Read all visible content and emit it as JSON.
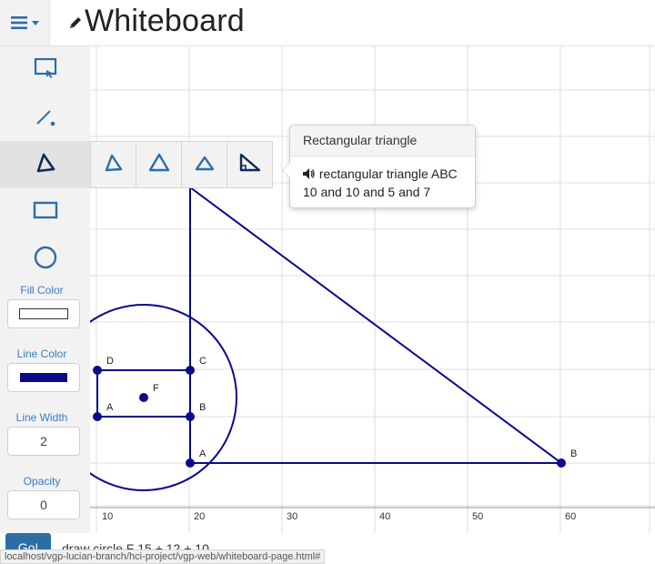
{
  "header": {
    "title": "Whiteboard",
    "menu_icon": "hamburger-icon",
    "title_icon": "pencil-icon"
  },
  "sidebar": {
    "tools": [
      {
        "name": "select",
        "icon": "select-icon"
      },
      {
        "name": "line",
        "icon": "line-icon"
      },
      {
        "name": "triangle",
        "icon": "triangle-icon",
        "active": true
      },
      {
        "name": "rectangle",
        "icon": "rectangle-icon"
      },
      {
        "name": "circle",
        "icon": "circle-icon"
      }
    ],
    "fill_color_label": "Fill Color",
    "line_color_label": "Line Color",
    "line_width_label": "Line Width",
    "line_width_value": "2",
    "opacity_label": "Opacity",
    "opacity_value": "0",
    "fill_color": "#ffffff",
    "line_color": "#0a0a8a"
  },
  "flyout": {
    "options": [
      "equilateral-triangle-icon",
      "isosceles-triangle-icon",
      "triangle-small-icon",
      "right-triangle-icon"
    ]
  },
  "tooltip": {
    "title": "Rectangular triangle",
    "line1": "rectangular triangle ABC",
    "line2": "10 and 10 and 5 and 7",
    "speaker_icon": "speaker-icon"
  },
  "canvas": {
    "x_ticks": [
      "10",
      "20",
      "30",
      "40",
      "50",
      "60"
    ],
    "point_labels": {
      "D": "D",
      "C": "C",
      "A1": "A",
      "B1": "B",
      "F": "F",
      "A2": "A",
      "B2": "B"
    },
    "stroke_color": "#0a0a8a",
    "grid_color": "#dcdcdc"
  },
  "command": {
    "go_label": "Go!",
    "value": "draw circle F 15 + 12 + 10"
  },
  "status": {
    "url": "localhost/vgp-lucian-branch/hci-project/vgp-web/whiteboard-page.html#"
  }
}
